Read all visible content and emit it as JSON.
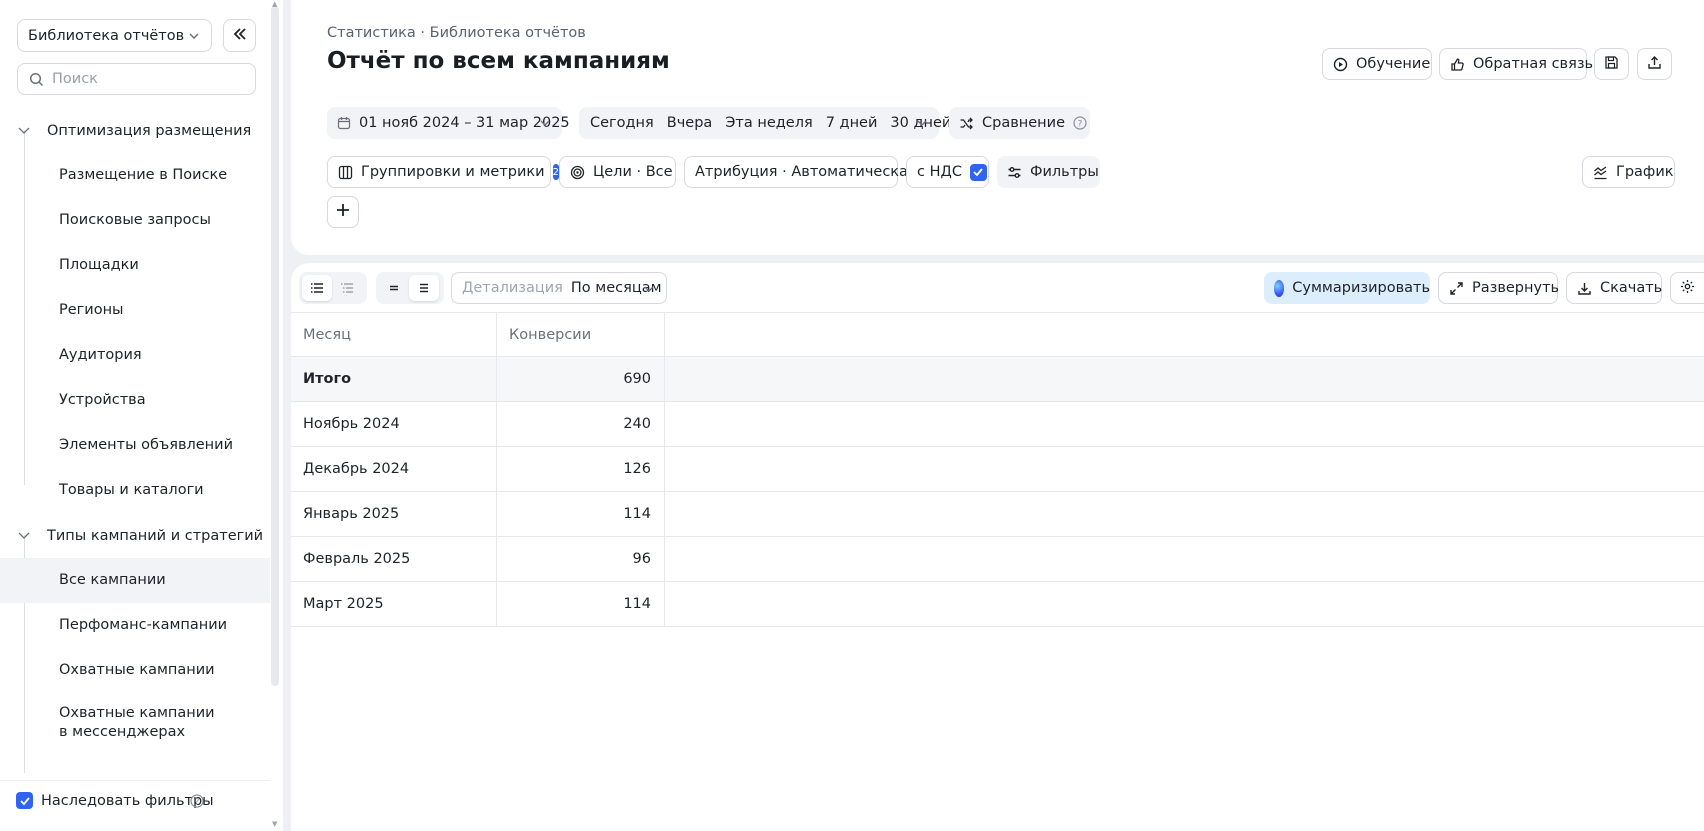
{
  "sidebar": {
    "library_select": "Библиотека отчётов",
    "search_placeholder": "Поиск",
    "groups": [
      {
        "label": "Оптимизация размещения",
        "items": [
          "Размещение в Поиске",
          "Поисковые запросы",
          "Площадки",
          "Регионы",
          "Аудитория",
          "Устройства",
          "Элементы объявлений",
          "Товары и каталоги"
        ]
      },
      {
        "label": "Типы кампаний и стратегий",
        "items": [
          "Все кампании",
          "Перфоманс-кампании",
          "Охватные кампании"
        ]
      }
    ],
    "multiline_item": {
      "line1": "Охватные кампании",
      "line2": "в мессенджерах"
    },
    "active_item": "Все кампании",
    "inherit_filters_label": "Наследовать фильтры",
    "inherit_filters_checked": true
  },
  "header": {
    "breadcrumb": "Статистика · Библиотека отчётов",
    "title": "Отчёт по всем кампаниям",
    "learning_label": "Обучение",
    "feedback_label": "Обратная связь"
  },
  "toolbar": {
    "date_range": "01 нояб 2024 – 31 мар 2025",
    "periods": [
      "Сегодня",
      "Вчера",
      "Эта неделя",
      "7 дней",
      "30 дней"
    ],
    "compare_label": "Сравнение",
    "groupings_label": "Группировки и метрики",
    "groupings_count": "2",
    "goals_label": "Цели · Все",
    "attribution_label": "Атрибуция · Автоматическая",
    "vat_label": "с НДС",
    "vat_checked": true,
    "filters_label": "Фильтры",
    "chart_label": "График"
  },
  "table_toolbar": {
    "detail_label": "Детализация",
    "detail_value": "По месяцам",
    "summarize_label": "Суммаризировать",
    "expand_label": "Развернуть",
    "download_label": "Скачать"
  },
  "table": {
    "columns": [
      "Месяц",
      "Конверсии"
    ],
    "total": {
      "label": "Итого",
      "value": "690"
    },
    "rows": [
      {
        "month": "Ноябрь 2024",
        "value": "240"
      },
      {
        "month": "Декабрь 2024",
        "value": "126"
      },
      {
        "month": "Январь 2025",
        "value": "114"
      },
      {
        "month": "Февраль 2025",
        "value": "96"
      },
      {
        "month": "Март 2025",
        "value": "114"
      }
    ]
  },
  "colors": {
    "accent": "#2f63f0",
    "summarize_bg": "#dcedfb",
    "page_bg": "#eef0f4"
  }
}
